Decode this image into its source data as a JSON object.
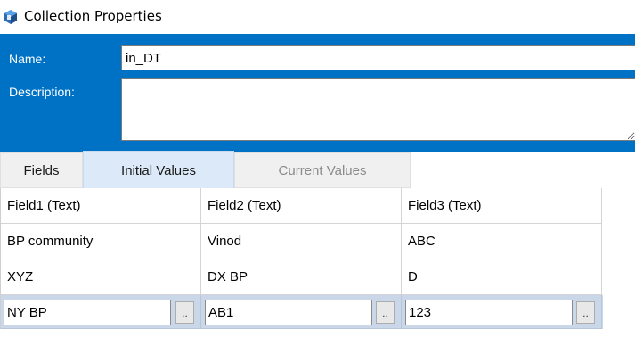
{
  "window": {
    "title": "Collection Properties",
    "icon": "blueprism-cube-icon"
  },
  "header": {
    "name_label": "Name:",
    "name_value": "in_DT",
    "description_label": "Description:",
    "description_value": ""
  },
  "tabs": [
    {
      "label": "Fields",
      "state": "normal"
    },
    {
      "label": "Initial Values",
      "state": "selected"
    },
    {
      "label": "Current Values",
      "state": "disabled"
    }
  ],
  "grid": {
    "columns": [
      "Field1  (Text)",
      "Field2  (Text)",
      "Field3  (Text)"
    ],
    "rows": [
      [
        "BP community",
        "Vinod",
        "ABC"
      ],
      [
        "XYZ",
        "DX BP",
        "D"
      ]
    ],
    "edit_row": [
      "NY BP",
      "AB1",
      "123"
    ],
    "ellipsis_label": ".."
  },
  "colors": {
    "header_blue": "#0072c6",
    "selected_tab": "#dce9f8",
    "edit_row": "#c9d7e8"
  }
}
